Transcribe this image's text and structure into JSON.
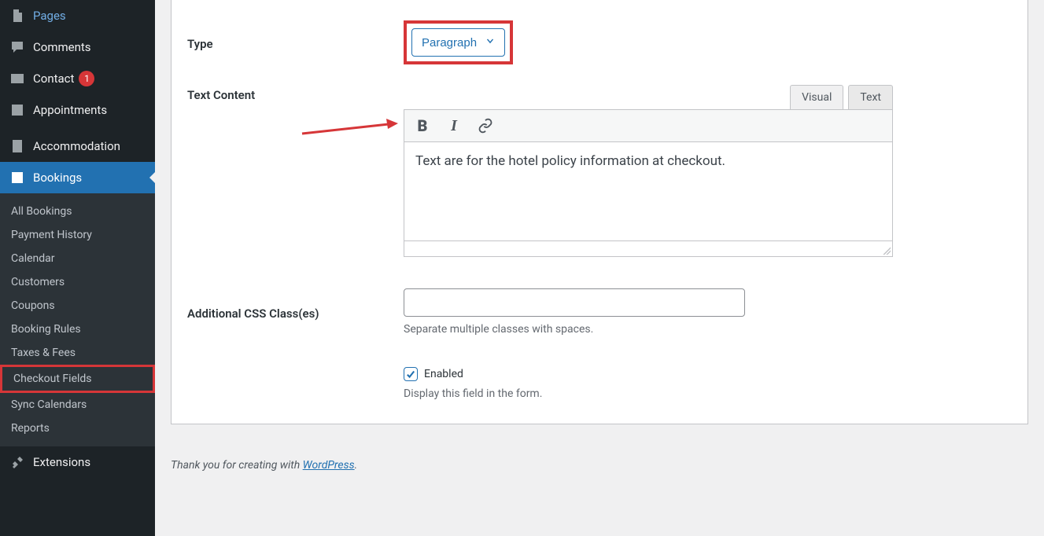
{
  "sidebar": {
    "pages": "Pages",
    "comments": "Comments",
    "contact": "Contact",
    "contact_badge": "1",
    "appointments": "Appointments",
    "accommodation": "Accommodation",
    "bookings": "Bookings",
    "extensions": "Extensions",
    "submenu": {
      "all_bookings": "All Bookings",
      "payment_history": "Payment History",
      "calendar": "Calendar",
      "customers": "Customers",
      "coupons": "Coupons",
      "booking_rules": "Booking Rules",
      "taxes_fees": "Taxes & Fees",
      "checkout_fields": "Checkout Fields",
      "sync_calendars": "Sync Calendars",
      "reports": "Reports"
    }
  },
  "form": {
    "type_label": "Type",
    "type_value": "Paragraph",
    "text_content_label": "Text Content",
    "tab_visual": "Visual",
    "tab_text": "Text",
    "editor_content": "Text are for the hotel policy information at checkout.",
    "css_label": "Additional CSS Class(es)",
    "css_value": "",
    "css_desc": "Separate multiple classes with spaces.",
    "enabled_label": "Enabled",
    "enabled_desc": "Display this field in the form."
  },
  "footer": {
    "prefix": "Thank you for creating with ",
    "link": "WordPress",
    "suffix": "."
  }
}
